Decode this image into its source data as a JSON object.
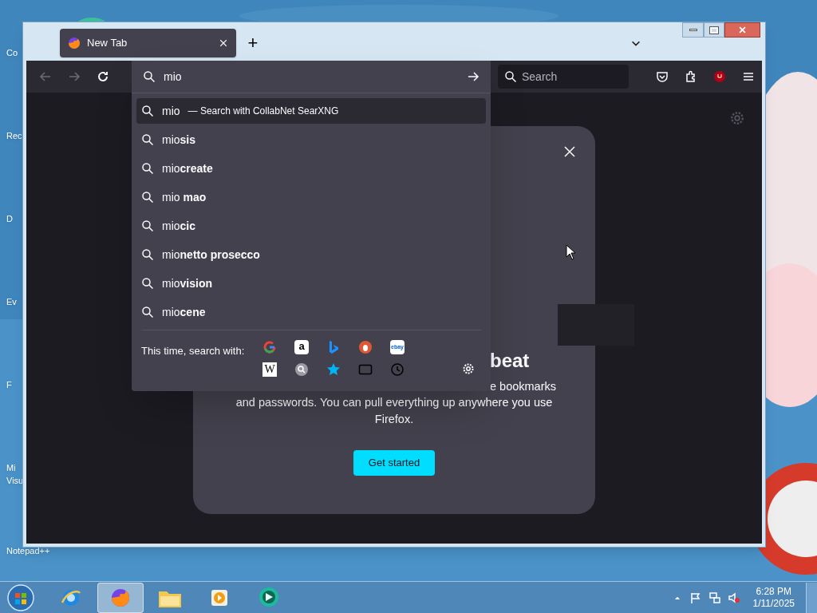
{
  "desktop_icons": [
    {
      "label": "Co"
    },
    {
      "label": "Rec"
    },
    {
      "label": "D"
    },
    {
      "label": "Ev"
    },
    {
      "label": "F"
    },
    {
      "label": "Mi"
    },
    {
      "label": "Visu"
    },
    {
      "label": "Notepad++"
    }
  ],
  "tabs": [
    {
      "title": "New Tab",
      "selected": true
    }
  ],
  "new_tab_button": "+",
  "address_bar": {
    "value": "mio"
  },
  "search_box": {
    "placeholder": "Search"
  },
  "suggestions": [
    {
      "kind": "engine",
      "text": "mio",
      "action": "— Search with CollabNet SearXNG",
      "selected": true
    },
    {
      "kind": "suggestion",
      "text": "mio**sis**",
      "selected": false
    },
    {
      "kind": "suggestion",
      "text": "mio**create**",
      "selected": false
    },
    {
      "kind": "suggestion",
      "text": "mio **mao**",
      "selected": false
    },
    {
      "kind": "suggestion",
      "text": "mio**cic**",
      "selected": false
    },
    {
      "kind": "suggestion",
      "text": "mio**netto prosecco**",
      "selected": false
    },
    {
      "kind": "suggestion",
      "text": "mio**vision**",
      "selected": false
    },
    {
      "kind": "suggestion",
      "text": "mio**cene**",
      "selected": false
    }
  ],
  "search_with": {
    "label": "This time, search with:",
    "engines": [
      {
        "kind": "google"
      },
      {
        "kind": "amazon",
        "glyph": "a"
      },
      {
        "kind": "bing"
      },
      {
        "kind": "duckduckgo"
      },
      {
        "kind": "ebay",
        "glyph": "ebay"
      },
      {
        "kind": "wikipedia",
        "glyph": "W"
      },
      {
        "kind": "search"
      },
      {
        "kind": "bookmarks"
      },
      {
        "kind": "tabs"
      },
      {
        "kind": "history"
      }
    ]
  },
  "modal": {
    "heading": "beat",
    "line_1": "e bookmarks",
    "paragraph": "and passwords. You can pull everything up anywhere you use Firefox.",
    "button": "Get started"
  },
  "taskbar": {
    "apps": [
      {
        "kind": "ie",
        "selected": false
      },
      {
        "kind": "firefox",
        "selected": true
      },
      {
        "kind": "explorer",
        "selected": false
      },
      {
        "kind": "media",
        "selected": false
      },
      {
        "kind": "chat",
        "selected": false
      }
    ],
    "time": "6:28 PM",
    "date": "1/11/2025"
  }
}
